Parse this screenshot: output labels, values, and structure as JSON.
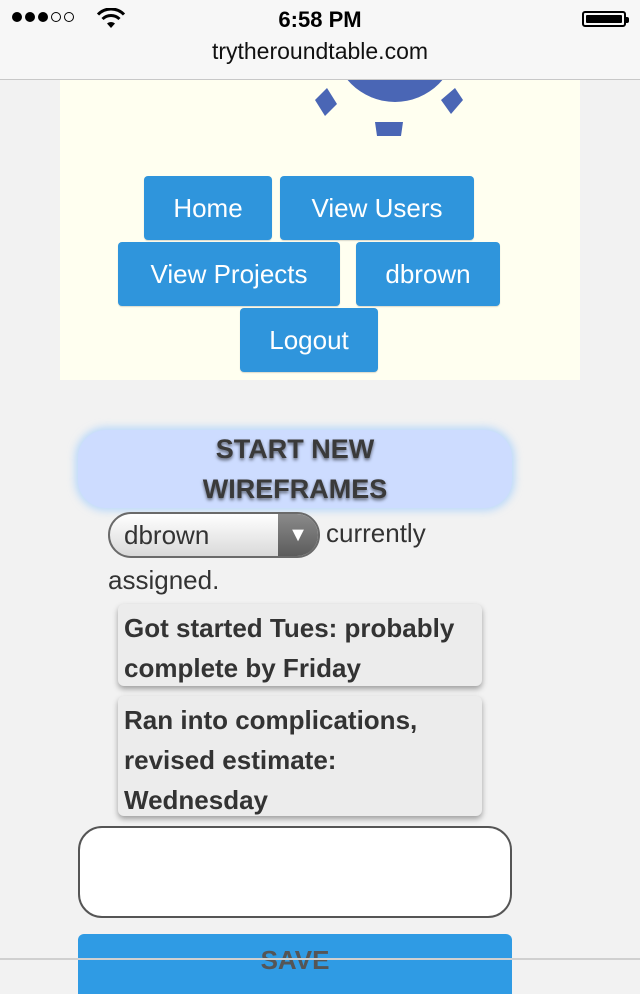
{
  "status_bar": {
    "signal_bars_filled": 3,
    "signal_bars_total": 5,
    "time": "6:58 PM",
    "battery_level": 1.0
  },
  "browser": {
    "url": "trytheroundtable.com"
  },
  "colors": {
    "accent": "#2f95dc",
    "title_bg": "#cddcff",
    "header_bg": "#fffff0",
    "logo": "#4a66b5"
  },
  "logo": {
    "icon": "roundtable-logo-icon"
  },
  "nav": {
    "home": "Home",
    "view_users": "View Users",
    "view_projects": "View Projects",
    "user": "dbrown",
    "logout": "Logout"
  },
  "task": {
    "title": "START NEW WIREFRAMES",
    "assignee": "dbrown",
    "assigned_text_1": "currently",
    "assigned_text_2": "assigned.",
    "notes": [
      "Got started Tues: probably complete by Friday",
      "Ran into complications, revised estimate: Wednesday"
    ],
    "comment_value": "",
    "save_label": "SAVE"
  }
}
